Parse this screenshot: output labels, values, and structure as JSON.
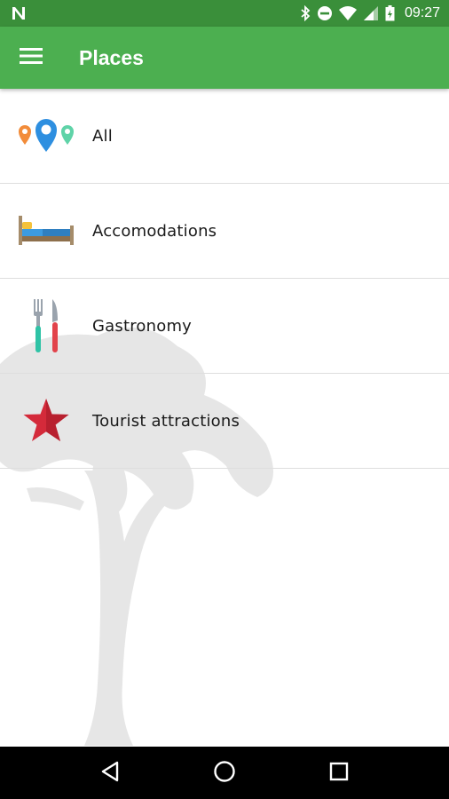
{
  "status_bar": {
    "time": "09:27",
    "icons": [
      "notification-n-icon",
      "bluetooth-icon",
      "do-not-disturb-icon",
      "wifi-icon",
      "signal-icon",
      "battery-icon"
    ]
  },
  "app_bar": {
    "title": "Places",
    "menu_icon": "hamburger-menu-icon"
  },
  "places": [
    {
      "label": "All",
      "icon": "map-pins-icon"
    },
    {
      "label": "Accomodations",
      "icon": "bed-icon"
    },
    {
      "label": "Gastronomy",
      "icon": "fork-knife-icon"
    },
    {
      "label": "Tourist attractions",
      "icon": "star-icon"
    }
  ],
  "nav_bar": {
    "icons": [
      "back-icon",
      "home-icon",
      "recents-icon"
    ]
  },
  "colors": {
    "status_bar": "#3a8f3a",
    "app_bar": "#4caf50",
    "divider": "#dedede",
    "watermark": "#e6e6e6"
  }
}
